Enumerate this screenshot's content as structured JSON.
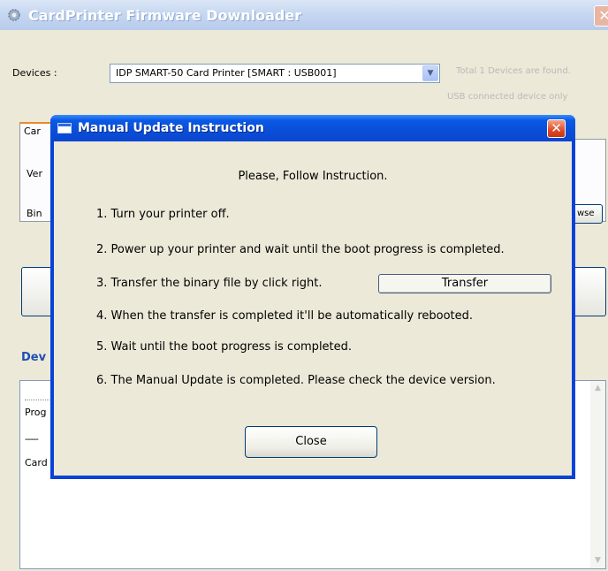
{
  "main_window": {
    "title": "CardPrinter Firmware Downloader",
    "close_glyph": "✕",
    "devices_label": "Devices :",
    "device_select_value": "IDP SMART-50 Card Printer [SMART : USB001]",
    "total_text": "Total   1 Devices are found.",
    "usb_note": "USB connected device only",
    "tab_label": "Car",
    "ver_label": "Ver",
    "bin_label": "Bin",
    "browse_label": "wse",
    "group_label": "Dev",
    "log_line_1": "Prog",
    "log_line_2": "-----",
    "log_line_3": "Card"
  },
  "dialog": {
    "title": "Manual Update Instruction",
    "close_glyph": "✕",
    "heading": "Please, Follow Instruction.",
    "steps": [
      "1. Turn your printer off.",
      "2. Power up your printer and wait until the boot progress is completed.",
      "3. Transfer the binary file by click right.",
      "4. When the transfer is completed it'll be automatically rebooted.",
      "5. Wait until the boot progress is completed.",
      "6. The Manual Update is completed. Please check the device version."
    ],
    "transfer_button": "Transfer",
    "close_button": "Close"
  },
  "icons": {
    "app_icon": "gear-icon",
    "dialog_icon": "window-icon",
    "dropdown_arrow": "chevron-down-icon",
    "scroll_up": "arrow-up-icon",
    "scroll_down": "arrow-down-icon"
  },
  "colors": {
    "dialog_titlebar": "#0a46d0",
    "close_red": "#e14a25",
    "window_face": "#ece9d8"
  }
}
